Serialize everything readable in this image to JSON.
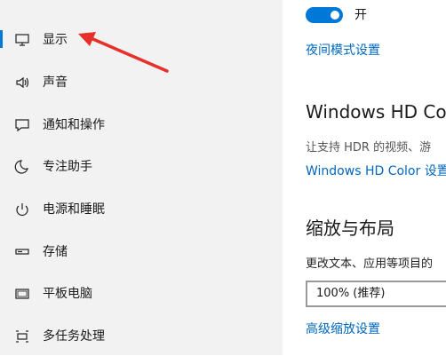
{
  "sidebar": {
    "items": [
      {
        "label": "显示",
        "icon": "monitor-icon"
      },
      {
        "label": "声音",
        "icon": "speaker-icon"
      },
      {
        "label": "通知和操作",
        "icon": "message-icon"
      },
      {
        "label": "专注助手",
        "icon": "moon-icon"
      },
      {
        "label": "电源和睡眠",
        "icon": "power-icon"
      },
      {
        "label": "存储",
        "icon": "storage-icon"
      },
      {
        "label": "平板电脑",
        "icon": "tablet-icon"
      },
      {
        "label": "多任务处理",
        "icon": "multitask-icon"
      }
    ],
    "selected": "显示"
  },
  "main": {
    "night_light": {
      "toggle_state": "开",
      "settings_link": "夜间模式设置"
    },
    "hdr": {
      "title": "Windows HD Colo",
      "description": "让支持 HDR 的视频、游",
      "settings_link": "Windows HD Color 设置"
    },
    "scale_layout": {
      "title": "缩放与布局",
      "scale_label": "更改文本、应用等项目的",
      "scale_value": "100% (推荐)",
      "advanced_link": "高级缩放设置"
    }
  },
  "colors": {
    "accent": "#0078d7",
    "link": "#0067c0",
    "sidebar_bg": "#f2f2f2",
    "annotation_arrow": "#e8302a"
  }
}
